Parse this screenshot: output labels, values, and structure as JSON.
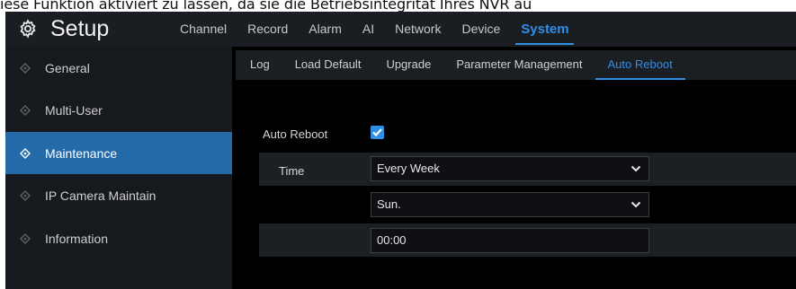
{
  "caption": "iese Funktion aktiviert zu lassen, da sie die Betriebsintegrität Ihres NVR au",
  "header": {
    "title": "Setup",
    "gear_icon": "gear-icon",
    "tabs": [
      {
        "label": "Channel"
      },
      {
        "label": "Record"
      },
      {
        "label": "Alarm"
      },
      {
        "label": "AI"
      },
      {
        "label": "Network"
      },
      {
        "label": "Device"
      },
      {
        "label": "System",
        "active": true
      }
    ]
  },
  "sidebar": {
    "items": [
      {
        "label": "General",
        "icon": "diamond-icon"
      },
      {
        "label": "Multi-User",
        "icon": "diamond-icon"
      },
      {
        "label": "Maintenance",
        "icon": "diamond-icon",
        "active": true
      },
      {
        "label": "IP Camera Maintain",
        "icon": "diamond-icon"
      },
      {
        "label": "Information",
        "icon": "diamond-icon"
      }
    ]
  },
  "subtabs": [
    {
      "label": "Log"
    },
    {
      "label": "Load Default"
    },
    {
      "label": "Upgrade"
    },
    {
      "label": "Parameter Management"
    },
    {
      "label": "Auto Reboot",
      "active": true
    }
  ],
  "form": {
    "auto_reboot_label": "Auto Reboot",
    "auto_reboot_checked": true,
    "time_label": "Time",
    "frequency_value": "Every Week",
    "day_value": "Sun.",
    "time_value": "00:00"
  },
  "colors": {
    "accent": "#2f8ee5",
    "sidebar_active": "#256aa8",
    "background": "#000000"
  }
}
